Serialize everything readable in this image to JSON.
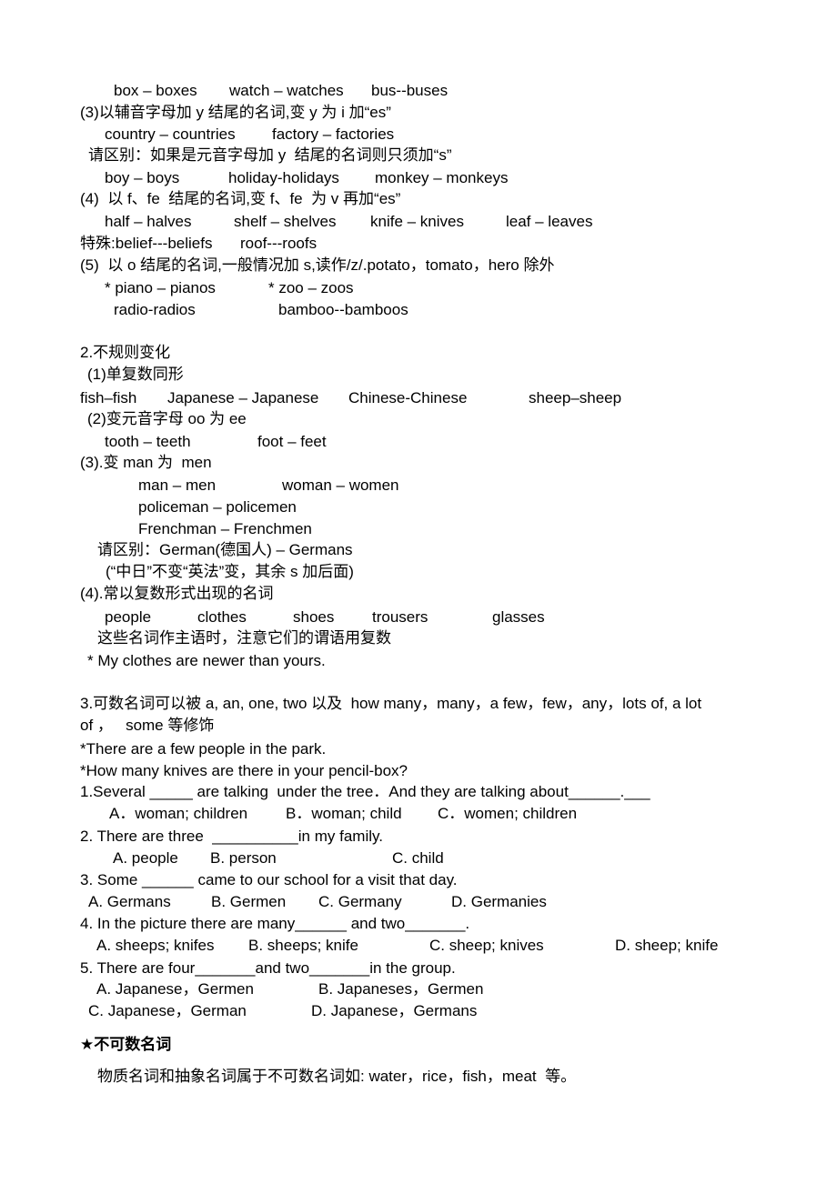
{
  "lines": [
    [
      "box – boxes",
      "watch – watches",
      "bus--buses"
    ],
    [
      "(3)以辅音字母加 y 结尾的名词,变 y 为 i 加“es”"
    ],
    [
      "country – countries",
      "factory – factories"
    ],
    [
      "请区别：如果是元音字母加 y  结尾的名词则只须加“s”"
    ],
    [
      "boy – boys",
      "holiday-holidays",
      "monkey – monkeys"
    ],
    [
      "(4)  以 f、fe  结尾的名词,变 f、fe  为 v 再加“es”"
    ],
    [
      "half – halves",
      "shelf – shelves",
      "knife – knives",
      "leaf – leaves"
    ],
    [
      "特殊:belief---beliefs",
      "roof---roofs"
    ],
    [
      "(5)  以 o 结尾的名词,一般情况加 s,读作/z/.potato，tomato，hero 除外"
    ],
    [
      "* piano – pianos",
      "* zoo – zoos"
    ],
    [
      "radio-radios",
      "bamboo--bamboos"
    ],
    [
      "2.不规则变化"
    ],
    [
      "(1)单复数同形"
    ],
    [
      "fish–fish",
      "Japanese – Japanese",
      "Chinese-Chinese",
      "sheep–sheep"
    ],
    [
      "(2)变元音字母 oo 为 ee"
    ],
    [
      "tooth – teeth",
      "foot – feet"
    ],
    [
      "(3).变 man 为  men"
    ],
    [
      "man – men",
      "woman – women"
    ],
    [
      "policeman – policemen"
    ],
    [
      "Frenchman – Frenchmen"
    ],
    [
      "请区别：German(德国人) – Germans"
    ],
    [
      "(“中日”不变“英法”变，其余 s 加后面)"
    ],
    [
      "(4).常以复数形式出现的名词"
    ],
    [
      "people",
      "clothes",
      "shoes",
      "trousers",
      "glasses"
    ],
    [
      "这些名词作主语时，注意它们的谓语用复数"
    ],
    [
      "* My clothes are newer than yours."
    ],
    [
      "3.可数名词可以被 a, an, one, two 以及  how many，many，a few，few，any，lots of, a lot"
    ],
    [
      "of ，   some 等修饰"
    ],
    [
      "*There are a few people in the park."
    ],
    [
      "*How many knives are there in your pencil-box?"
    ],
    [
      "1.Several _____ are talking  under the tree．And they are talking about______.___"
    ],
    [
      "A．woman; children",
      "B．woman; child",
      "C．women; children"
    ],
    [
      "2. There are three  __________in my family."
    ],
    [
      "A. people",
      "B. person",
      "C. child"
    ],
    [
      "3. Some ______ came to our school for a visit that day."
    ],
    [
      "A. Germans",
      "B. Germen",
      "C. Germany",
      "D. Germanies"
    ],
    [
      "4. In the picture there are many______ and two_______."
    ],
    [
      "A. sheeps; knifes",
      "B. sheeps; knife",
      "C. sheep; knives",
      "D. sheep; knife"
    ],
    [
      "5. There are four_______and two_______in the group."
    ],
    [
      "A. Japanese，Germen",
      "B. Japaneses，Germen"
    ],
    [
      "C. Japanese，German",
      "D. Japanese，Germans"
    ],
    [
      "★不可数名词"
    ],
    [
      "物质名词和抽象名词属于不可数名词如: water，rice，fish，meat  等。"
    ]
  ]
}
